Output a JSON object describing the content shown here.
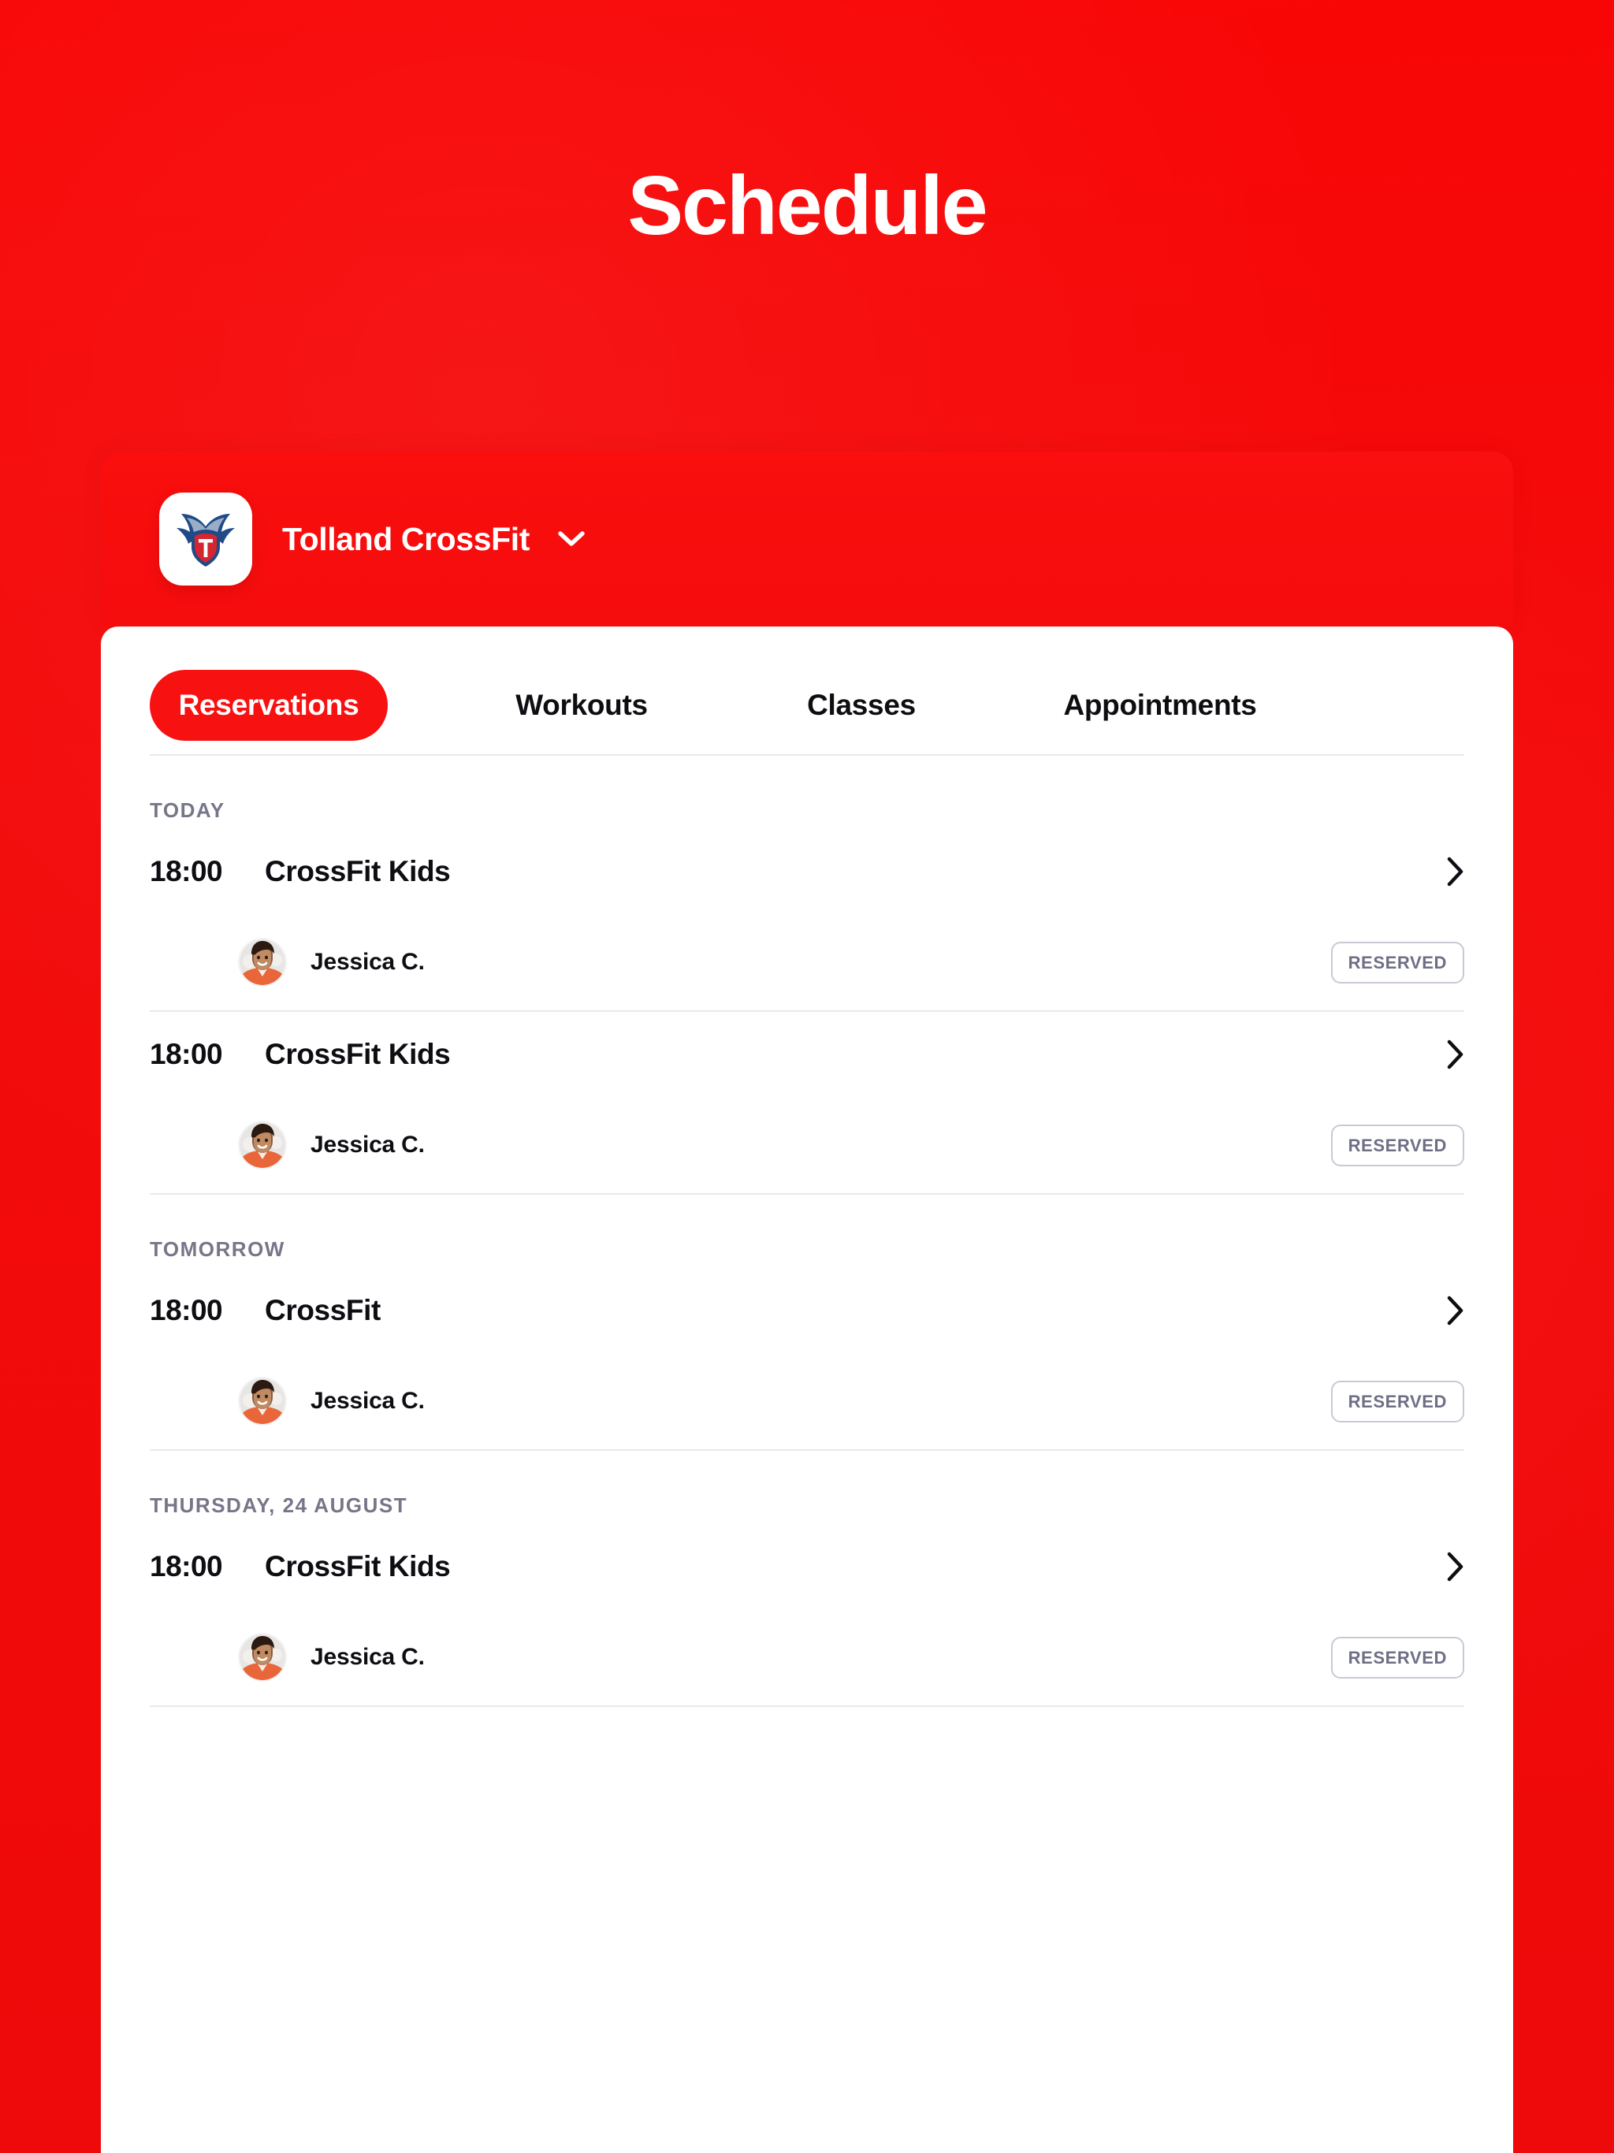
{
  "page": {
    "title": "Schedule",
    "background_color": "#F40C0C",
    "accent_color": "#F71111"
  },
  "card": {
    "gym_name": "Tolland CrossFit",
    "gym_logo_icon": "winged-shield-logo",
    "gym_selector_icon": "chevron-down-icon"
  },
  "tabs": [
    {
      "label": "Reservations",
      "active": true
    },
    {
      "label": "Workouts",
      "active": false
    },
    {
      "label": "Classes",
      "active": false
    },
    {
      "label": "Appointments",
      "active": false
    }
  ],
  "sections": [
    {
      "label": "TODAY",
      "entries": [
        {
          "time": "18:00",
          "class_name": "CrossFit Kids",
          "chevron_icon": "chevron-right-icon",
          "attendee": {
            "name": "Jessica C.",
            "avatar_icon": "user-avatar-photo",
            "status": "RESERVED"
          }
        },
        {
          "time": "18:00",
          "class_name": "CrossFit Kids",
          "chevron_icon": "chevron-right-icon",
          "attendee": {
            "name": "Jessica C.",
            "avatar_icon": "user-avatar-photo",
            "status": "RESERVED"
          }
        }
      ]
    },
    {
      "label": "TOMORROW",
      "entries": [
        {
          "time": "18:00",
          "class_name": "CrossFit",
          "chevron_icon": "chevron-right-icon",
          "attendee": {
            "name": "Jessica C.",
            "avatar_icon": "user-avatar-photo",
            "status": "RESERVED"
          }
        }
      ]
    },
    {
      "label": "THURSDAY, 24 AUGUST",
      "entries": [
        {
          "time": "18:00",
          "class_name": "CrossFit Kids",
          "chevron_icon": "chevron-right-icon",
          "attendee": {
            "name": "Jessica C.",
            "avatar_icon": "user-avatar-photo",
            "status": "RESERVED"
          }
        }
      ]
    }
  ]
}
